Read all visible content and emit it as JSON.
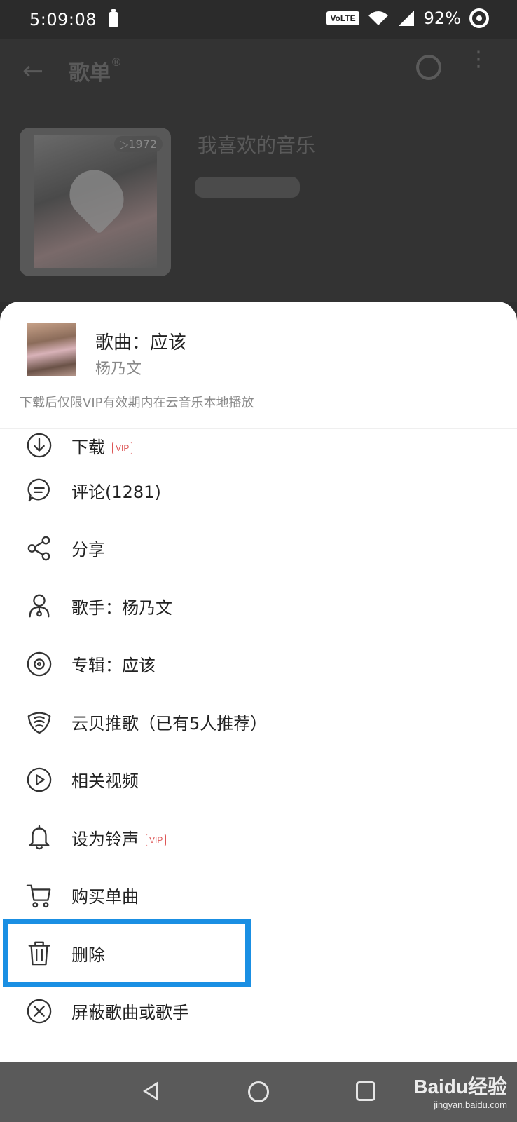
{
  "status_bar": {
    "time": "5:09:08",
    "network": "VoLTE",
    "battery_percent": "92%"
  },
  "background_app": {
    "title": "歌单",
    "title_mark": "®",
    "playlist_name": "我喜欢的音乐",
    "play_count": "▷1972"
  },
  "song": {
    "title": "歌曲：应该",
    "artist": "杨乃文",
    "note": "下载后仅限VIP有效期内在云音乐本地播放"
  },
  "menu": {
    "items": [
      {
        "label": "下载",
        "badge": "VIP",
        "icon": "download-icon"
      },
      {
        "label": "评论(1281)",
        "icon": "comment-icon"
      },
      {
        "label": "分享",
        "icon": "share-icon"
      },
      {
        "label": "歌手：杨乃文",
        "icon": "singer-icon"
      },
      {
        "label": "专辑：应该",
        "icon": "album-icon"
      },
      {
        "label": "云贝推歌（已有5人推荐）",
        "icon": "cloud-coin-icon"
      },
      {
        "label": "相关视频",
        "icon": "video-icon"
      },
      {
        "label": "设为铃声",
        "badge": "VIP",
        "icon": "bell-icon"
      },
      {
        "label": "购买单曲",
        "icon": "cart-icon"
      },
      {
        "label": "删除",
        "icon": "trash-icon"
      },
      {
        "label": "屏蔽歌曲或歌手",
        "icon": "block-icon"
      }
    ]
  },
  "highlight_color": "#1a8fe3",
  "watermark": {
    "brand": "Baidu经验",
    "url": "jingyan.baidu.com"
  }
}
